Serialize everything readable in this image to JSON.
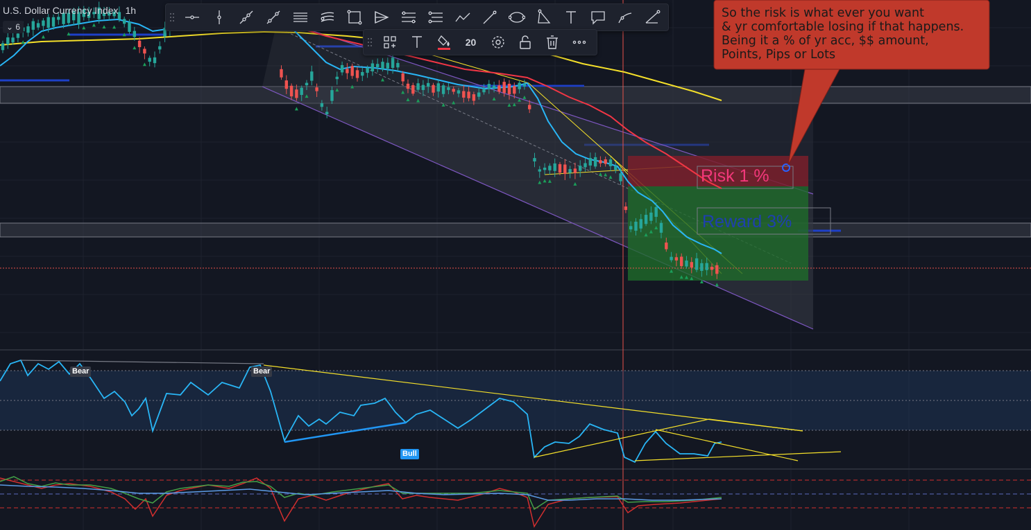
{
  "symbol": {
    "name": "U.S. Dollar Currency Index",
    "timeframe": "1h"
  },
  "legend": {
    "count": "6"
  },
  "drawing_toolbar": {
    "tools": [
      {
        "name": "horizontal-ray-icon"
      },
      {
        "name": "vertical-line-icon"
      },
      {
        "name": "trend-line-icon"
      },
      {
        "name": "extended-line-icon"
      },
      {
        "name": "parallel-channel-icon"
      },
      {
        "name": "regression-trend-icon"
      },
      {
        "name": "rectangle-icon"
      },
      {
        "name": "pitchfork-icon"
      },
      {
        "name": "fib-retracement-icon"
      },
      {
        "name": "fib-extension-icon"
      },
      {
        "name": "path-icon"
      },
      {
        "name": "brush-icon"
      },
      {
        "name": "ellipse-icon"
      },
      {
        "name": "triangle-icon"
      },
      {
        "name": "text-icon"
      },
      {
        "name": "callout-icon"
      },
      {
        "name": "arrow-marker-icon"
      },
      {
        "name": "angle-line-icon"
      }
    ]
  },
  "properties_toolbar": {
    "font_size": "20",
    "text_color": "#f23645"
  },
  "callout": {
    "lines": [
      "So the risk is what ever you want",
      "& yr comfortable losing if that happens.",
      "Being it a % of yr acc, $$ amount,",
      "Points, Pips  or Lots"
    ],
    "background": "#c0392b"
  },
  "position": {
    "risk_label": "Risk 1 %",
    "reward_label": "Reward 3%",
    "risk_color": "#f2387a",
    "reward_color": "#1e3fb0"
  },
  "oscillator": {
    "signals": [
      {
        "label": "Bear",
        "type": "bear"
      },
      {
        "label": "Bear",
        "type": "bear"
      },
      {
        "label": "Bull",
        "type": "bull"
      }
    ]
  },
  "colors": {
    "background": "#131722",
    "up_candle": "#26a69a",
    "down_candle": "#ef5350",
    "ema_fast": "#29b6f6",
    "ema_mid": "#f23645",
    "ema_slow": "#f5e02a",
    "channel": "#7e57c2",
    "crosshair": "#e8524a"
  }
}
